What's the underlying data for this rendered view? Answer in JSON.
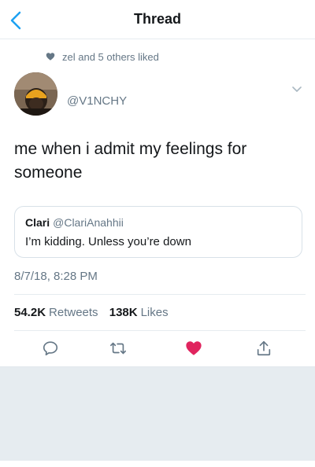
{
  "navbar": {
    "title": "Thread"
  },
  "social_context": {
    "text": "zel and 5 others liked"
  },
  "tweet": {
    "handle": "@V1NCHY",
    "text": "me when i admit my feelings for someone",
    "timestamp": "8/7/18, 8:28 PM"
  },
  "quote": {
    "name": "Clari",
    "handle": "@ClariAnahhii",
    "text": "I’m kidding. Unless you’re down"
  },
  "stats": {
    "retweets_count": "54.2K",
    "retweets_label": "Retweets",
    "likes_count": "138K",
    "likes_label": "Likes"
  },
  "colors": {
    "accent": "#1da1f2",
    "like_active": "#e0245e",
    "muted": "#657786",
    "divider": "#e6ecf0"
  },
  "icons": [
    "back-chevron-icon",
    "heart-icon",
    "caret-down-icon",
    "reply-icon",
    "retweet-icon",
    "like-icon",
    "share-icon"
  ]
}
